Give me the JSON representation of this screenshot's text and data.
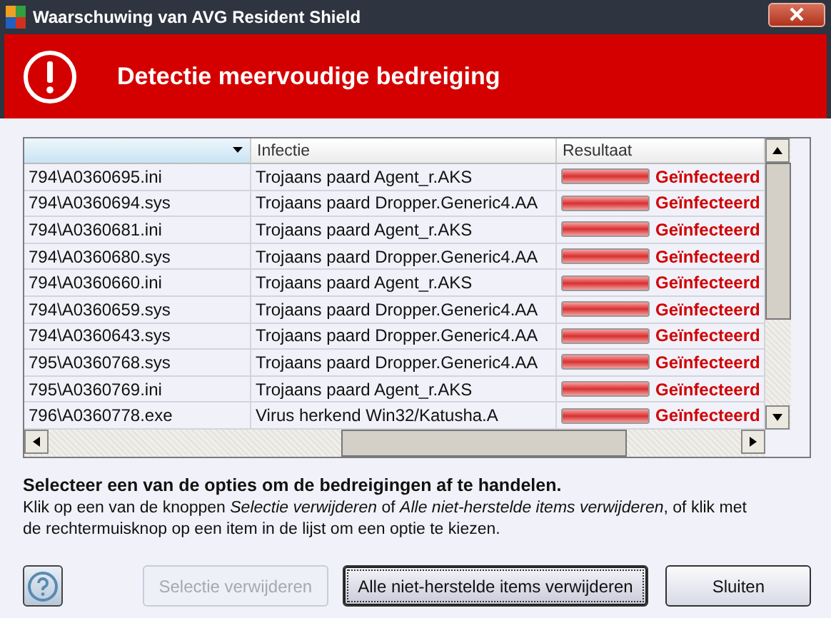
{
  "window": {
    "title": "Waarschuwing van AVG Resident Shield"
  },
  "header": {
    "title": "Detectie meervoudige bedreiging"
  },
  "table": {
    "columns": [
      "Infectie",
      "Resultaat"
    ],
    "rows": [
      {
        "file": "794\\A0360695.ini",
        "infection": "Trojaans paard Agent_r.AKS",
        "result": "Geïnfecteerd"
      },
      {
        "file": "794\\A0360694.sys",
        "infection": "Trojaans paard Dropper.Generic4.AA",
        "result": "Geïnfecteerd"
      },
      {
        "file": "794\\A0360681.ini",
        "infection": "Trojaans paard Agent_r.AKS",
        "result": "Geïnfecteerd"
      },
      {
        "file": "794\\A0360680.sys",
        "infection": "Trojaans paard Dropper.Generic4.AA",
        "result": "Geïnfecteerd"
      },
      {
        "file": "794\\A0360660.ini",
        "infection": "Trojaans paard Agent_r.AKS",
        "result": "Geïnfecteerd"
      },
      {
        "file": "794\\A0360659.sys",
        "infection": "Trojaans paard Dropper.Generic4.AA",
        "result": "Geïnfecteerd"
      },
      {
        "file": "794\\A0360643.sys",
        "infection": "Trojaans paard Dropper.Generic4.AA",
        "result": "Geïnfecteerd"
      },
      {
        "file": "795\\A0360768.sys",
        "infection": "Trojaans paard Dropper.Generic4.AA",
        "result": "Geïnfecteerd"
      },
      {
        "file": "795\\A0360769.ini",
        "infection": "Trojaans paard Agent_r.AKS",
        "result": "Geïnfecteerd"
      },
      {
        "file": "796\\A0360778.exe",
        "infection": "Virus herkend Win32/Katusha.A",
        "result": "Geïnfecteerd"
      }
    ]
  },
  "instructions": {
    "heading": "Selecteer een van de opties om de bedreigingen af te handelen.",
    "text": "Klik op een van de knoppen *Selectie verwijderen* of *Alle niet-herstelde items verwijderen*, of klik met de rechtermuisknop op een item in de lijst om een optie te kiezen."
  },
  "buttons": [
    {
      "label": "Selectie verwijderen",
      "disabled": true,
      "focused": false
    },
    {
      "label": "Alle niet-herstelde items verwijderen",
      "disabled": false,
      "focused": true
    },
    {
      "label": "Sluiten",
      "disabled": false,
      "focused": false
    }
  ]
}
